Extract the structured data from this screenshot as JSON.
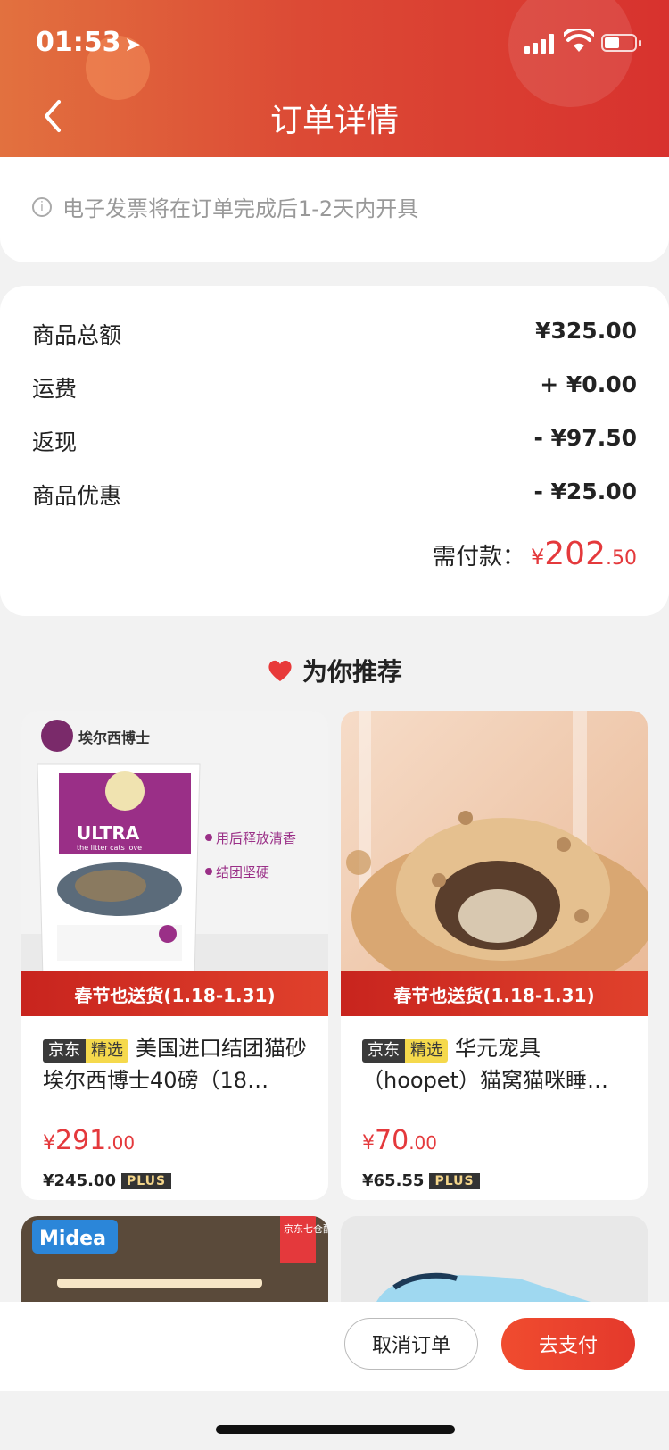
{
  "status_bar": {
    "time": "01:53"
  },
  "header": {
    "title": "订单详情"
  },
  "invoice": {
    "note": "电子发票将在订单完成后1-2天内开具"
  },
  "summary": {
    "rows": [
      {
        "label": "商品总额",
        "value": "¥325.00"
      },
      {
        "label": "运费",
        "value": "+ ¥0.00"
      },
      {
        "label": "返现",
        "value": "- ¥97.50"
      },
      {
        "label": "商品优惠",
        "value": "- ¥25.00"
      }
    ],
    "total_label": "需付款：",
    "total_symbol": "¥",
    "total_int": "202",
    "total_dec": ".50"
  },
  "recommend": {
    "heading": "为你推荐",
    "products": [
      {
        "tag_jd": "京东",
        "tag_jx": "精选",
        "name": "美国进口结团猫砂埃尔西博士40磅（18…",
        "banner": "春节也送货(1.18-1.31)",
        "price_symbol": "¥",
        "price_int": "291",
        "price_dec": ".00",
        "plus_price": "¥245.00",
        "plus_label": "PLUS",
        "brand_text": "埃尔西博士",
        "pack_text": "ULTRA",
        "pack_sub": "the litter cats love",
        "feature1": "用后释放清香",
        "feature2": "结团坚硬"
      },
      {
        "tag_jd": "京东",
        "tag_jx": "精选",
        "name": "华元宠具（hoopet）猫窝猫咪睡…",
        "banner": "春节也送货(1.18-1.31)",
        "price_symbol": "¥",
        "price_int": "70",
        "price_dec": ".00",
        "plus_price": "¥65.55",
        "plus_label": "PLUS"
      }
    ],
    "partial": [
      {
        "brand": "Midea",
        "badge": "京东七仓配送"
      }
    ]
  },
  "actions": {
    "cancel": "取消订单",
    "pay": "去支付"
  },
  "colors": {
    "accent": "#e4393c",
    "header": "#d8322e"
  }
}
